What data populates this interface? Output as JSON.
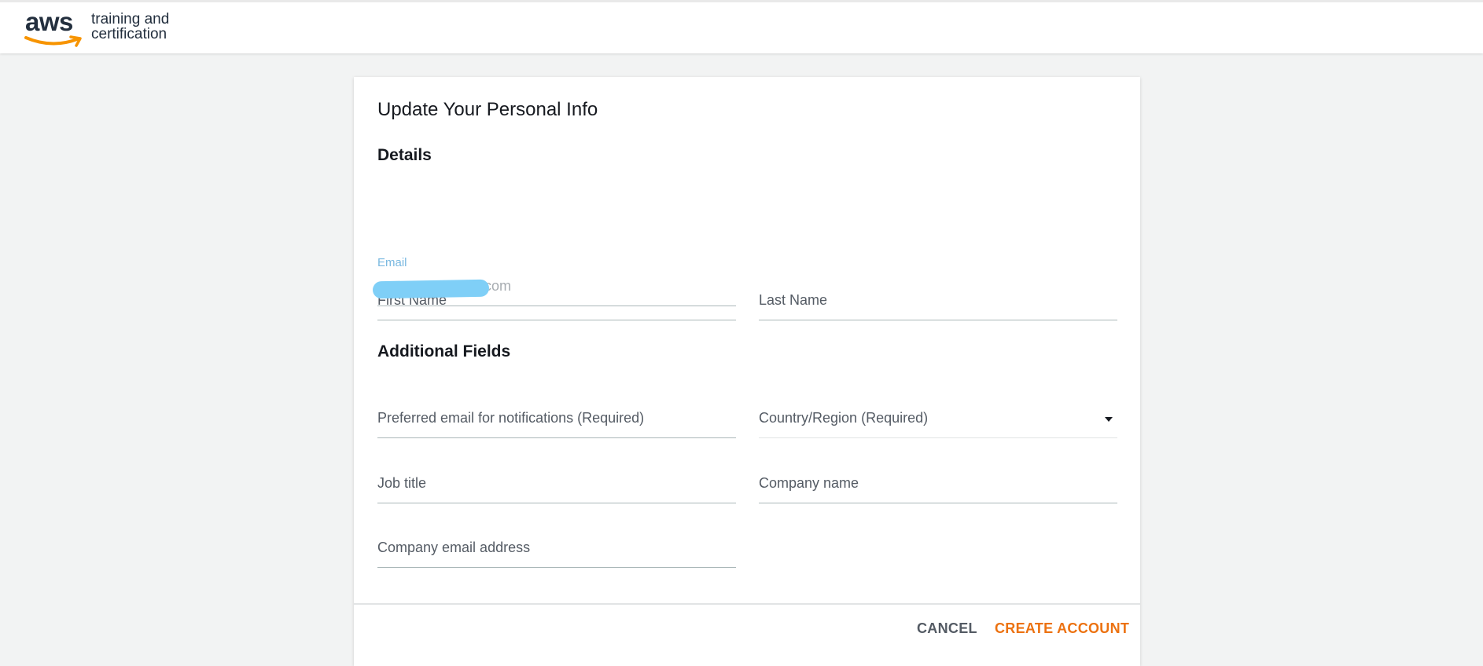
{
  "header": {
    "logo_word": "aws",
    "logo_line1": "training and",
    "logo_line2": "certification"
  },
  "form": {
    "title": "Update Your Personal Info",
    "details_heading": "Details",
    "first_name_placeholder": "First Name",
    "last_name_placeholder": "Last Name",
    "email_label": "Email",
    "email_value_visible": "com",
    "additional_heading": "Additional Fields",
    "preferred_email_placeholder": "Preferred email for notifications (Required)",
    "country_placeholder": "Country/Region (Required)",
    "job_title_placeholder": "Job title",
    "company_name_placeholder": "Company name",
    "company_email_placeholder": "Company email address"
  },
  "footer": {
    "cancel_label": "CANCEL",
    "create_label": "CREATE ACCOUNT"
  },
  "colors": {
    "brand_orange": "#ec7211",
    "aws_navy": "#232f3e",
    "label_blue": "#79b8e0",
    "redaction": "#7fcff7"
  },
  "icons": {
    "dropdown": "caret-down-icon",
    "logo_smile": "amazon-smile-icon"
  }
}
